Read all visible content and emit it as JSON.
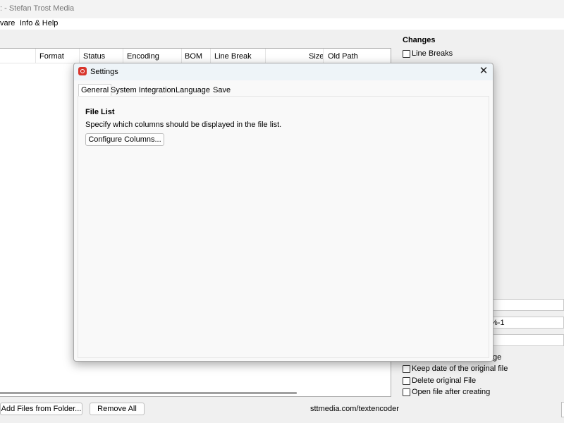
{
  "window": {
    "title": ": - Stefan Trost Media"
  },
  "menu": [
    "vare",
    "Info & Help"
  ],
  "file_list": {
    "columns": [
      "Format",
      "Status",
      "Encoding",
      "BOM",
      "Line Break",
      "Size",
      "Old Path"
    ]
  },
  "changes": {
    "title": "Changes",
    "line_breaks_label": "Line Breaks"
  },
  "right_fields": {
    "field2_value": "%-1"
  },
  "options": {
    "partial_label": "ge",
    "keep_date_label": "Keep date of the original file",
    "delete_original_label": "Delete original File",
    "open_after_label": "Open file after creating"
  },
  "bottom": {
    "add_folder_label": "Add Files from Folder...",
    "remove_all_label": "Remove All",
    "link_text": "sttmedia.com/textencoder"
  },
  "dialog": {
    "title": "Settings",
    "close_glyph": "✕",
    "tabs": [
      "General",
      "System Integration",
      "Language",
      "Save"
    ],
    "active_tab": "General",
    "section_title": "File List",
    "section_desc": "Specify which columns should be displayed in the file list.",
    "configure_button": "Configure Columns..."
  },
  "colors": {
    "app_icon": "#d8352c",
    "dialog_title_bg": "#eef4f8"
  }
}
